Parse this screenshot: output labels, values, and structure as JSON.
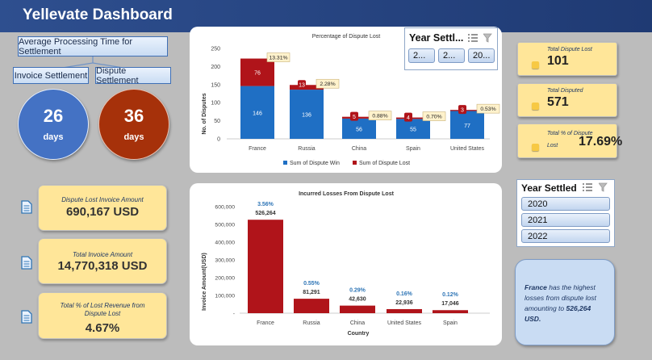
{
  "header": {
    "title": "Yellevate Dashboard"
  },
  "processing": {
    "title": "Average Processing Time for Settlement",
    "invoice_label": "Invoice Settlement",
    "dispute_label": "Dispute Settlement",
    "invoice_value": "26",
    "invoice_unit": "days",
    "dispute_value": "36",
    "dispute_unit": "days"
  },
  "left_kpis": [
    {
      "label": "Dispute Lost Invoice Amount",
      "value": "690,167 USD"
    },
    {
      "label": "Total Invoice Amount",
      "value": "14,770,318 USD"
    },
    {
      "label": "Total % of Lost Revenue from Dispute Lost",
      "value": "4.67%"
    }
  ],
  "right_kpis": [
    {
      "label": "Total Dispute Lost",
      "value": "101"
    },
    {
      "label": "Total Disputed",
      "value": "571"
    },
    {
      "label": "Total % of Dispute Lost",
      "value": "17.69%"
    }
  ],
  "slicer_small": {
    "title": "Year Settl...",
    "items": [
      "2...",
      "2...",
      "20..."
    ]
  },
  "slicer_large": {
    "title": "Year Settled",
    "items": [
      "2020",
      "2021",
      "2022"
    ]
  },
  "note": {
    "country": "France",
    "text": " has the highest losses  from dispute lost amounting to ",
    "amount": "526,264 USD."
  },
  "colors": {
    "win": "#1f6fc4",
    "lost": "#b0141a",
    "header": "#1f3a73",
    "kpi": "#ffe699"
  },
  "chart_data": [
    {
      "type": "bar",
      "stacked": true,
      "title": "Percentage of Dispute Lost",
      "ylabel": "No. of Disputes",
      "xlabel": "",
      "ylim": [
        0,
        250
      ],
      "yticks": [
        0,
        50,
        100,
        150,
        200,
        250
      ],
      "categories": [
        "France",
        "Russia",
        "China",
        "Spain",
        "United States"
      ],
      "series": [
        {
          "name": "Sum of Dispute Win",
          "values": [
            146,
            136,
            56,
            55,
            77
          ]
        },
        {
          "name": "Sum of Dispute Lost",
          "values": [
            76,
            13,
            5,
            4,
            3
          ]
        }
      ],
      "annotations": [
        "13.31%",
        "2.28%",
        "0.88%",
        "0.70%",
        "0.53%"
      ],
      "legend": "bottom"
    },
    {
      "type": "bar",
      "title": "Incurred Losses From Dispute Lost",
      "ylabel": "Invoice Amount(USD)",
      "xlabel": "Country",
      "ylim": [
        0,
        600000
      ],
      "yticks": [
        "-",
        "100,000",
        "200,000",
        "300,000",
        "400,000",
        "500,000",
        "600,000"
      ],
      "categories": [
        "France",
        "Russia",
        "China",
        "United States",
        "Spain"
      ],
      "values": [
        526264,
        81291,
        42630,
        22936,
        17046
      ],
      "value_labels": [
        "526,264",
        "81,291",
        "42,630",
        "22,936",
        "17,046"
      ],
      "pct_labels": [
        "3.56%",
        "0.55%",
        "0.29%",
        "0.16%",
        "0.12%"
      ]
    }
  ]
}
